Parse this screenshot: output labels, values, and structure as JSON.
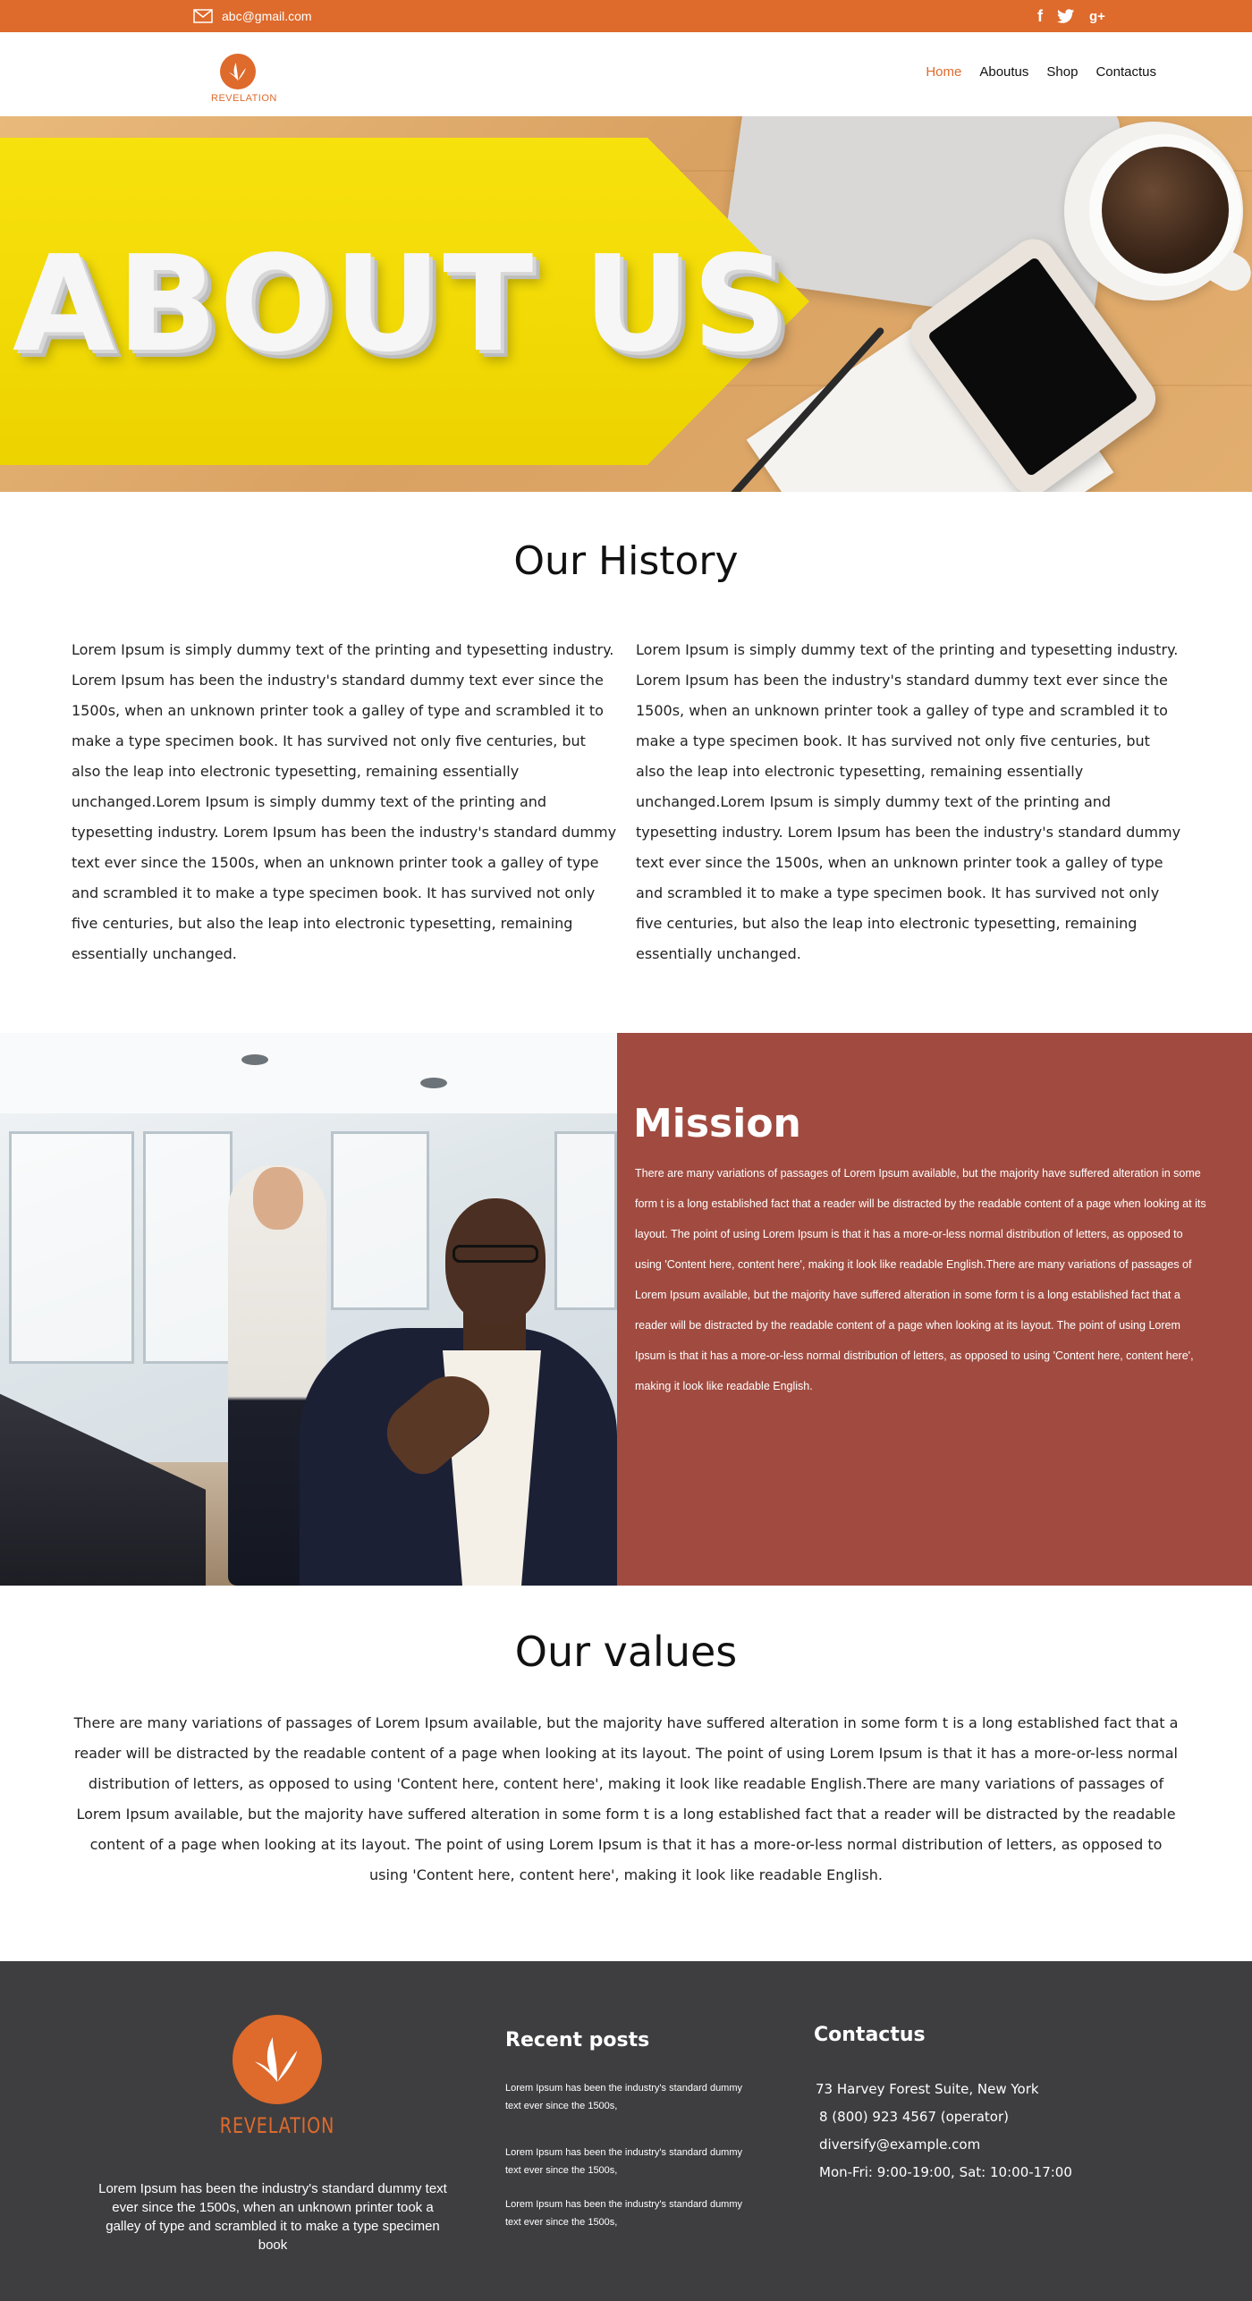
{
  "topbar": {
    "email": "abc@gmail.com",
    "social": [
      "f",
      "t",
      "g+"
    ]
  },
  "header": {
    "logo_text": "REVELATION",
    "nav": [
      "Home",
      "Aboutus",
      "Shop",
      "Contactus"
    ],
    "active_nav": "Home"
  },
  "hero": {
    "title": "ABOUT US"
  },
  "history": {
    "title": "Our History",
    "paragraph": "Lorem Ipsum is simply dummy text of the printing and typesetting industry. Lorem Ipsum has been the industry's standard dummy text ever since the 1500s, when an unknown printer took a galley of type and scrambled it to make a type specimen book. It has survived not only five centuries, but also the leap into electronic typesetting, remaining essentially unchanged.Lorem Ipsum is simply dummy text of the printing and typesetting industry. Lorem Ipsum has been the industry's standard dummy text ever since the 1500s, when an unknown printer took a galley of type and scrambled it to make a type specimen book. It has survived not only five centuries, but also the leap into electronic typesetting, remaining essentially unchanged."
  },
  "mission": {
    "title": "Mission",
    "text": "There are many variations of passages of Lorem Ipsum available, but the majority have suffered alteration in some form t is a long established fact that a reader will be distracted by the readable content of a page when looking at its layout. The point of using Lorem Ipsum is that it has a more-or-less normal distribution of letters, as opposed to using 'Content here, content here', making it look like readable English.There are many variations of passages of Lorem Ipsum available, but the majority have suffered alteration in some form t is a long established fact that a reader will be distracted by the readable content of a page when looking at its layout. The point of using Lorem Ipsum is that it has a more-or-less normal distribution of letters, as opposed to using 'Content here, content here', making it look like readable English."
  },
  "values": {
    "title": "Our values",
    "text": "There are many variations of passages of Lorem Ipsum available, but the majority have suffered alteration in some form t is a long established fact that a reader will be distracted by the readable content of a page when looking at its layout. The point of using Lorem Ipsum is that it has a more-or-less normal distribution of letters, as opposed to using 'Content here, content here', making it look like readable English.There are many variations of passages of Lorem Ipsum available, but the majority have suffered alteration in some form t is a long established fact that a reader will be distracted by the readable content of a page when looking at its layout. The point of using Lorem Ipsum is that it has a more-or-less normal distribution of letters, as opposed to using 'Content here, content here', making it look like readable English."
  },
  "footer": {
    "logo_text": "REVELATION",
    "about": "Lorem Ipsum has been the industry's standard dummy text ever since the 1500s, when an unknown printer took a galley of type and scrambled it to make a type specimen book",
    "recent_posts_title": "Recent posts",
    "posts": [
      "Lorem Ipsum has been the industry's standard dummy text ever since the 1500s,",
      "Lorem Ipsum has been the industry's standard dummy text ever since the 1500s,",
      "Lorem Ipsum has been the industry's standard dummy text ever since the 1500s,"
    ],
    "contact_title": "Contactus",
    "contact": [
      "73 Harvey Forest Suite, New York",
      "8 (800) 923 4567 (operator)",
      "diversify@example.com",
      "Mon-Fri: 9:00-19:00, Sat: 10:00-17:00"
    ]
  },
  "colors": {
    "accent": "#de6a2c",
    "mission_bg": "#a14b40",
    "footer_bg": "#3e3e40"
  }
}
